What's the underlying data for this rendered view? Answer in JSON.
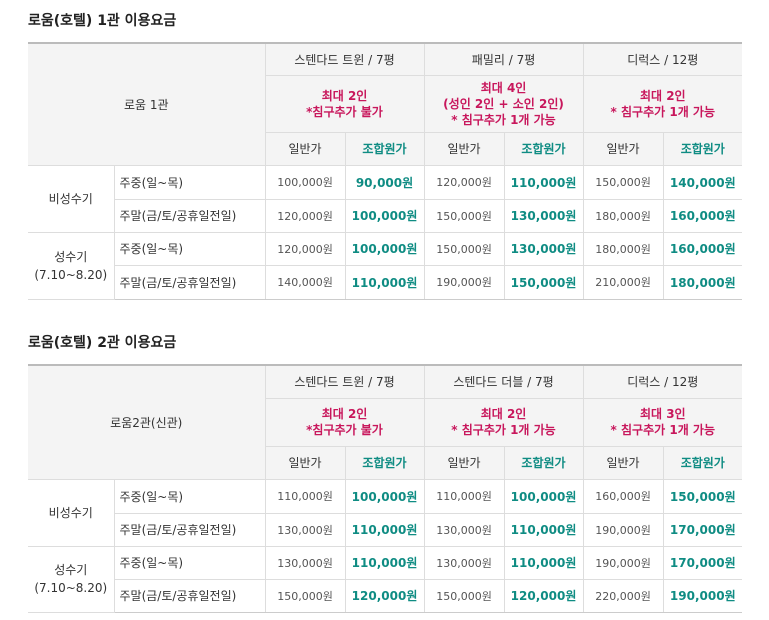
{
  "sections": [
    {
      "title": "로움(호텔) 1관 이용요금",
      "corner_label": "로움 1관",
      "rooms": [
        {
          "name": "스텐다드 트윈 / 7평",
          "occupancy": [
            "최대 2인",
            "*침구추가 불가"
          ]
        },
        {
          "name": "패밀리 / 7평",
          "occupancy": [
            "최대 4인",
            "(성인 2인 + 소인 2인)",
            "* 침구추가 1개 가능"
          ]
        },
        {
          "name": "디럭스 / 12평",
          "occupancy": [
            "최대 2인",
            "* 침구추가 1개 가능"
          ]
        }
      ],
      "price_label": "일반가",
      "combo_label": "조합원가",
      "seasons": [
        {
          "name": [
            "비성수기"
          ],
          "rows": [
            {
              "day": "주중(일~목)",
              "prices": [
                "100,000원",
                "90,000원",
                "120,000원",
                "110,000원",
                "150,000원",
                "140,000원"
              ]
            },
            {
              "day": "주말(금/토/공휴일전일)",
              "prices": [
                "120,000원",
                "100,000원",
                "150,000원",
                "130,000원",
                "180,000원",
                "160,000원"
              ]
            }
          ]
        },
        {
          "name": [
            "성수기",
            "(7.10~8.20)"
          ],
          "rows": [
            {
              "day": "주중(일~목)",
              "prices": [
                "120,000원",
                "100,000원",
                "150,000원",
                "130,000원",
                "180,000원",
                "160,000원"
              ]
            },
            {
              "day": "주말(금/토/공휴일전일)",
              "prices": [
                "140,000원",
                "110,000원",
                "190,000원",
                "150,000원",
                "210,000원",
                "180,000원"
              ]
            }
          ]
        }
      ]
    },
    {
      "title": "로움(호텔) 2관 이용요금",
      "corner_label": "로움2관(신관)",
      "rooms": [
        {
          "name": "스텐다드 트윈 / 7평",
          "occupancy": [
            "최대 2인",
            "*침구추가 불가"
          ]
        },
        {
          "name": "스텐다드 더블 / 7평",
          "occupancy": [
            "최대 2인",
            "* 침구추가 1개 가능"
          ]
        },
        {
          "name": "디럭스 / 12평",
          "occupancy": [
            "최대 3인",
            "* 침구추가 1개 가능"
          ]
        }
      ],
      "price_label": "일반가",
      "combo_label": "조합원가",
      "seasons": [
        {
          "name": [
            "비성수기"
          ],
          "rows": [
            {
              "day": "주중(일~목)",
              "prices": [
                "110,000원",
                "100,000원",
                "110,000원",
                "100,000원",
                "160,000원",
                "150,000원"
              ]
            },
            {
              "day": "주말(금/토/공휴일전일)",
              "prices": [
                "130,000원",
                "110,000원",
                "130,000원",
                "110,000원",
                "190,000원",
                "170,000원"
              ]
            }
          ]
        },
        {
          "name": [
            "성수기",
            "(7.10~8.20)"
          ],
          "rows": [
            {
              "day": "주중(일~목)",
              "prices": [
                "130,000원",
                "110,000원",
                "130,000원",
                "110,000원",
                "190,000원",
                "170,000원"
              ]
            },
            {
              "day": "주말(금/토/공휴일전일)",
              "prices": [
                "150,000원",
                "120,000원",
                "150,000원",
                "120,000원",
                "220,000원",
                "190,000원"
              ]
            }
          ]
        }
      ]
    }
  ],
  "colors": {
    "accent_pink": "#c8175c",
    "accent_teal": "#0f8c83",
    "header_gray": "#f4f4f4"
  }
}
